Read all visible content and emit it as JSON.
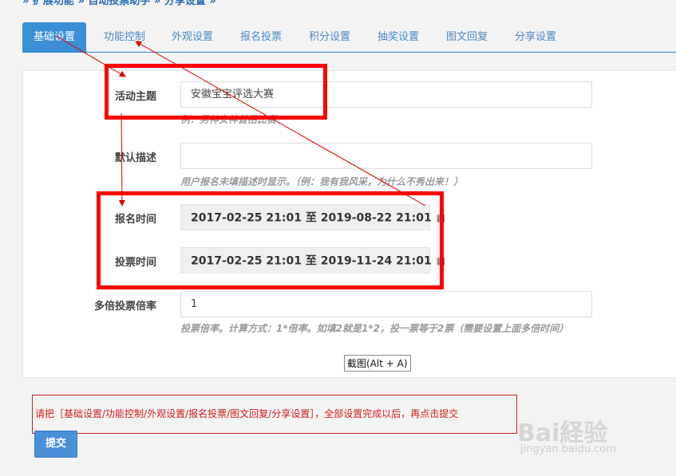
{
  "breadcrumb": {
    "text": "» 扩展功能 » 自动投票助手 » 分享设置 »"
  },
  "tabs": [
    {
      "label": "基础设置"
    },
    {
      "label": "功能控制"
    },
    {
      "label": "外观设置"
    },
    {
      "label": "报名投票"
    },
    {
      "label": "积分设置"
    },
    {
      "label": "抽奖设置"
    },
    {
      "label": "图文回复"
    },
    {
      "label": "分享设置"
    }
  ],
  "form": {
    "topic": {
      "label": "活动主题",
      "value": "安徽宝宝评选大赛",
      "hint": "例：男神女神首招比赛"
    },
    "description": {
      "label": "默认描述",
      "value": "",
      "hint": "用户报名未填描述时显示。（例：我有我风采，为什么不秀出来！）"
    },
    "signup_time": {
      "label": "报名时间",
      "value": "2017-02-25 21:01 至 2019-08-22 21:01"
    },
    "vote_time": {
      "label": "投票时间",
      "value": "2017-02-25 21:01 至 2019-11-24 21:01"
    },
    "multiplier": {
      "label": "多倍投票倍率",
      "value": "1",
      "hint": "投票倍率。计算方式：1*倍率。如填2就是1*2，投一票等于2票（需要设置上面多倍时间）"
    }
  },
  "tooltip": {
    "text": "截图(Alt + A)"
  },
  "notice": {
    "text": "请把［基础设置/功能控制/外观设置/报名投票/图文回复/分享设置］，全部设置完成以后，再点击提交"
  },
  "submit": {
    "label": "提交"
  },
  "watermark": {
    "brand": "Bai経验",
    "url": "jingyan.baidu.com"
  },
  "icons": {
    "calendar": "calendar-icon"
  },
  "colors": {
    "accent": "#3b8fd6",
    "annotation": "#ff0000",
    "hint": "#9a9a9a"
  }
}
